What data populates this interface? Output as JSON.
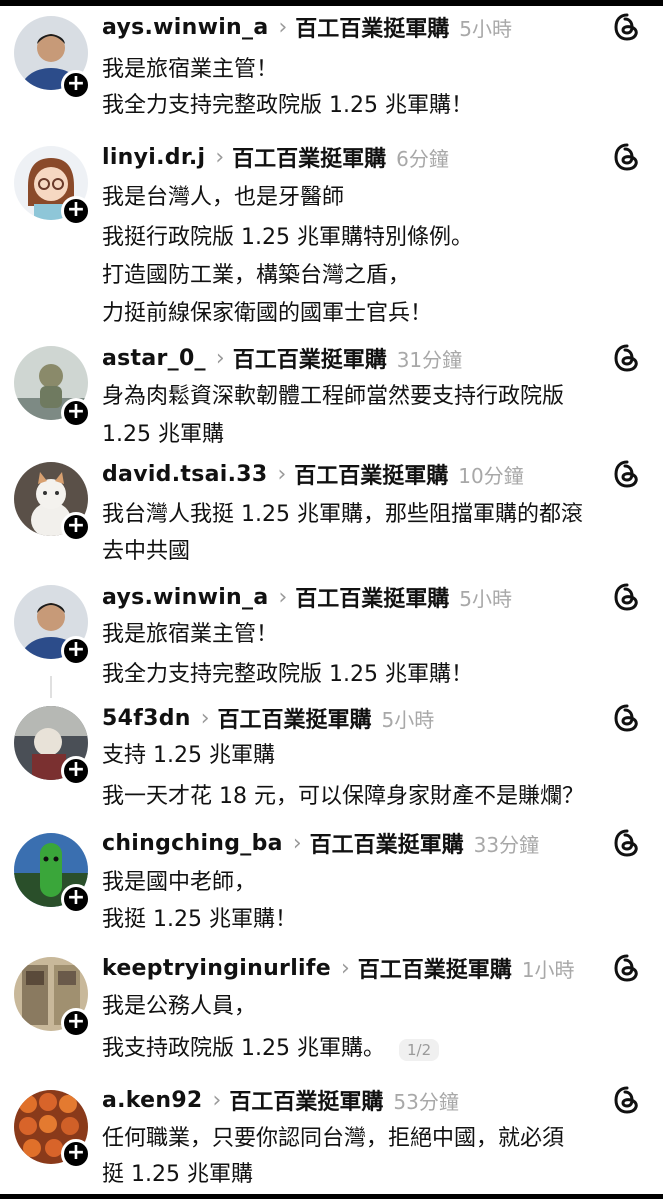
{
  "posts": [
    {
      "username": "ays.winwin_a",
      "topic": "百工百業挺軍購",
      "time": "5小時",
      "avatar": "man-avatar",
      "lines": [
        "我是旅宿業主管！",
        "我全力支持完整政院版 1.25 兆軍購！"
      ]
    },
    {
      "username": "linyi.dr.j",
      "topic": "百工百業挺軍購",
      "time": "6分鐘",
      "avatar": "cartoon-girl-avatar",
      "lines": [
        "我是台灣人，也是牙醫師",
        "我挺行政院版 1.25 兆軍購特別條例。",
        "打造國防工業，構築台灣之盾，",
        "力挺前線保家衛國的國軍士官兵！"
      ]
    },
    {
      "username": "astar_0_",
      "topic": "百工百業挺軍購",
      "time": "31分鐘",
      "avatar": "statue-avatar",
      "lines": [
        "身為肉鬆資深軟韌體工程師當然要支持行政院版",
        "1.25 兆軍購"
      ]
    },
    {
      "username": "david.tsai.33",
      "topic": "百工百業挺軍購",
      "time": "10分鐘",
      "avatar": "cat-avatar",
      "lines": [
        "我台灣人我挺 1.25 兆軍購，那些阻擋軍購的都滾",
        "去中共國"
      ]
    },
    {
      "username": "ays.winwin_a",
      "topic": "百工百業挺軍購",
      "time": "5小時",
      "avatar": "man-avatar",
      "lines": [
        "我是旅宿業主管！",
        "我全力支持完整政院版 1.25 兆軍購！"
      ]
    },
    {
      "username": "54f3dn",
      "topic": "百工百業挺軍購",
      "time": "5小時",
      "avatar": "figure-avatar",
      "lines": [
        "支持 1.25 兆軍購",
        "我一天才花 18 元，可以保障身家財產不是賺爛？"
      ]
    },
    {
      "username": "chingching_ba",
      "topic": "百工百業挺軍購",
      "time": "33分鐘",
      "avatar": "cactus-avatar",
      "lines": [
        "我是國中老師，",
        "我挺 1.25 兆軍購！"
      ]
    },
    {
      "username": "keeptryinginurlife",
      "topic": "百工百業挺軍購",
      "time": "1小時",
      "avatar": "room-avatar",
      "lines": [
        "我是公務人員，",
        "我支持政院版 1.25 兆軍購。"
      ],
      "pager": "1/2"
    },
    {
      "username": "a.ken92",
      "topic": "百工百業挺軍購",
      "time": "53分鐘",
      "avatar": "oranges-avatar",
      "lines": [
        "任何職業，只要你認同台灣，拒絕中國，就必須",
        "挺 1.25 兆軍購"
      ]
    }
  ],
  "icons": {
    "plus": "+",
    "chevron": "›",
    "threads": "threads-logo-icon"
  }
}
